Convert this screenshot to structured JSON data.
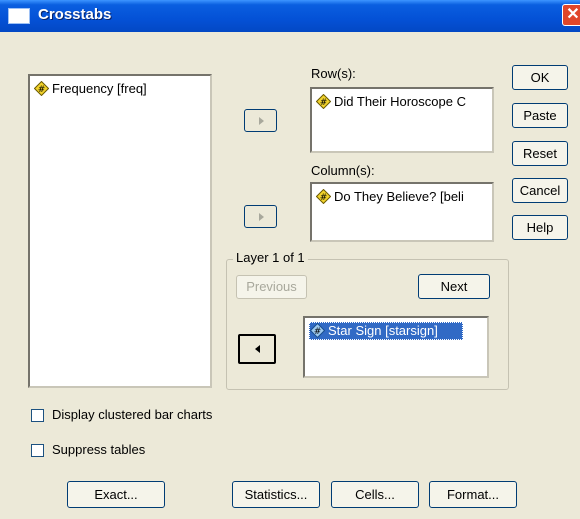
{
  "window": {
    "title": "Crosstabs",
    "close_glyph": "✕"
  },
  "source_list": {
    "items": [
      {
        "label": "Frequency [freq]",
        "icon": "scale-variable-icon"
      }
    ]
  },
  "rows": {
    "label": "Row(s):",
    "items": [
      {
        "label": "Did Their Horoscope C",
        "icon": "scale-variable-icon"
      }
    ]
  },
  "columns": {
    "label": "Column(s):",
    "items": [
      {
        "label": "Do They Believe? [beli",
        "icon": "scale-variable-icon"
      }
    ]
  },
  "layer": {
    "label": "Layer 1 of 1",
    "previous_label": "Previous",
    "next_label": "Next",
    "items": [
      {
        "label": "Star Sign [starsign]",
        "icon": "nominal-variable-icon",
        "selected": true
      }
    ]
  },
  "buttons": {
    "ok": "OK",
    "paste": "Paste",
    "reset": "Reset",
    "cancel": "Cancel",
    "help": "Help"
  },
  "options": {
    "clustered_bar": "Display clustered bar charts",
    "suppress_tables": "Suppress tables"
  },
  "bottom_buttons": {
    "exact": "Exact...",
    "statistics": "Statistics...",
    "cells": "Cells...",
    "format": "Format..."
  },
  "colors": {
    "titlebar": "#0451d6",
    "selection": "#316ac5",
    "dialog_bg": "#ece9d8",
    "variable_icon": "#f2d32b"
  }
}
